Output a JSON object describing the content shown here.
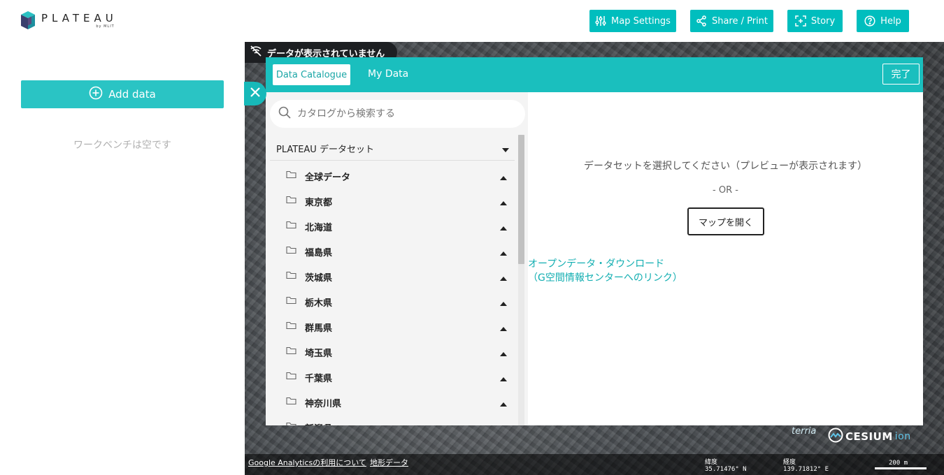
{
  "header": {
    "logo_title": "PLATEAU",
    "logo_sub": "by MLIT",
    "buttons": {
      "map_settings": "Map Settings",
      "share_print": "Share / Print",
      "story": "Story",
      "help": "Help"
    }
  },
  "workbench": {
    "add_data": "Add data",
    "empty_text": "ワークベンチは空です"
  },
  "map": {
    "no_data_text": "データが表示されていません",
    "attributions": [
      "Google Analyticsの利用について",
      "地形データ"
    ],
    "coords": {
      "lat_label": "緯度",
      "lat_value": "35.71476° N",
      "lon_label": "経度",
      "lon_value": "139.71812° E"
    },
    "scale_label": "200 m",
    "terria_logo": "terria",
    "cesium_logo": "CESIUM",
    "cesium_ion": "ion"
  },
  "catalogue": {
    "tabs": [
      "Data Catalogue",
      "My Data"
    ],
    "active_tab": "Data Catalogue",
    "done_button": "完了",
    "search_placeholder": "カタログから検索する",
    "group_title": "PLATEAU データセット",
    "items": [
      "全球データ",
      "東京都",
      "北海道",
      "福島県",
      "茨城県",
      "栃木県",
      "群馬県",
      "埼玉県",
      "千葉県",
      "神奈川県",
      "新潟県"
    ],
    "preview_message": "データセットを選択してください（プレビューが表示されます）",
    "or_text": "- OR -",
    "open_map_button": "マップを開く",
    "open_data_link_line1": "オープンデータ・ダウンロード",
    "open_data_link_line2": "（G空間情報センターへのリンク）"
  },
  "colors": {
    "accent": "#00bebe",
    "header_bar": "#1abfbe",
    "link": "#12aeb1"
  }
}
